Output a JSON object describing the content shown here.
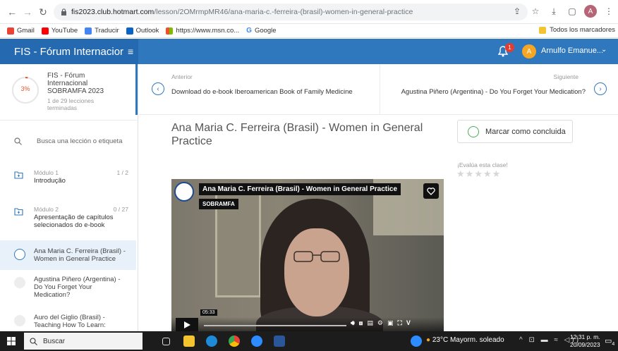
{
  "browser": {
    "url_host": "fis2023.club.hotmart.com",
    "url_path": "/lesson/2OMrmpMR46/ana-maria-c.-ferreira-(brasil)-women-in-general-practice",
    "profile_initial": "A",
    "bookmarks": [
      {
        "label": "Gmail",
        "color": "#ea4335"
      },
      {
        "label": "YouTube",
        "color": "#ff0000"
      },
      {
        "label": "Traducir",
        "color": "#4285f4"
      },
      {
        "label": "Outlook",
        "color": "#0a64c8"
      },
      {
        "label": "https://www.msn.co...",
        "color": "#f25022"
      },
      {
        "label": "Google",
        "color": "#4285f4"
      }
    ],
    "bookmarks_folder": "Todos los marcadores"
  },
  "header": {
    "brand": "FIS - Fórum Internacior",
    "menu_icon": "≡",
    "notification_count": "1",
    "user_initial": "A",
    "user_name": "Arnulfo Emanue...",
    "accent_color": "#2f78be"
  },
  "sidebar": {
    "progress_percent": 3,
    "progress_label": "3%",
    "course_title": "FIS - Fórum Internacional SOBRAMFA 2023",
    "lessons_done": "1 de 29 lecciones terminadas",
    "search_placeholder": "Busca una lección o etiqueta",
    "modules": [
      {
        "label": "Módulo 1",
        "count": "1 / 2",
        "title": "Introdução"
      },
      {
        "label": "Módulo 2",
        "count": "0 / 27",
        "title": "Apresentação de capítulos selecionados do e-book"
      }
    ],
    "lessons": [
      {
        "title": "Ana Maria C. Ferreira (Brasil) - Women in General Practice",
        "active": true
      },
      {
        "title": "Agustina Piñero (Argentina) - Do You Forget Your Medication?",
        "active": false
      },
      {
        "title": "Auro del Giglio (Brasil) - Teaching How To Learn:",
        "active": false
      }
    ]
  },
  "nav": {
    "prev_label": "Anterior",
    "prev_title": "Download do e-book Iberoamerican Book of Family Medicine",
    "next_label": "Siguiente",
    "next_title": "Agustina Piñero (Argentina) - Do You Forget Your Medication?"
  },
  "lesson": {
    "title": "Ana Maria C. Ferreira (Brasil) - Women in General Practice",
    "mark_complete": "Marcar como concluida",
    "rate_label": "¡Evalúa esta clase!",
    "stars": 5
  },
  "video": {
    "title": "Ana Maria C. Ferreira (Brasil) - Women in General Practice",
    "channel": "SOBRAMFA",
    "time_tooltip": "05:33"
  },
  "taskbar": {
    "search": "Buscar",
    "weather": "23°C  Mayorm. soleado",
    "time": "12:31 p. m.",
    "date": "20/09/2023",
    "notif_count": "4"
  }
}
